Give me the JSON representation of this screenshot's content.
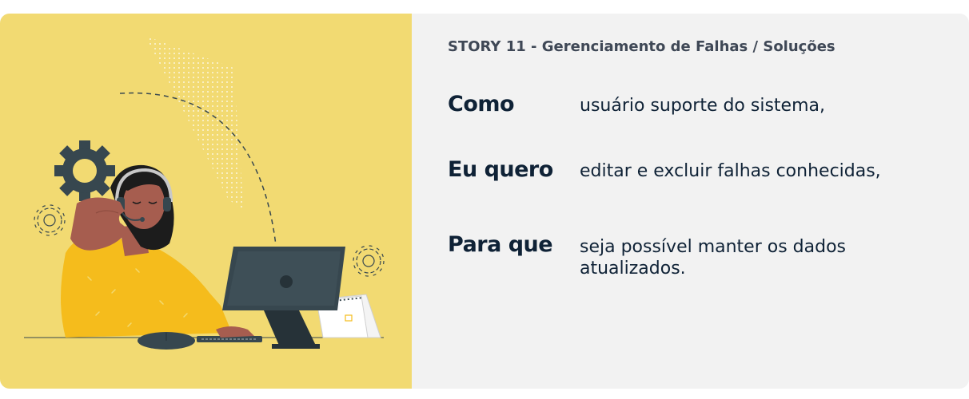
{
  "story": {
    "title": "STORY 11 - Gerenciamento de Falhas / Soluções"
  },
  "rows": [
    {
      "label": "Como",
      "text": "usuário suporte do sistema,"
    },
    {
      "label": "Eu quero",
      "text": "editar e excluir falhas conhecidas,"
    },
    {
      "label": "Para que",
      "text": "seja possível manter os dados atualizados."
    }
  ],
  "illustration": {
    "icon": "support-agent-illustration",
    "colors": {
      "background": "#f2da72",
      "shirt": "#f5bc1c",
      "skin": "#a65d4f",
      "hair": "#1c1c1c",
      "monitor": "#37474f",
      "gear": "#37474f"
    }
  },
  "colors": {
    "panel_background": "#f2f2f2",
    "heading_text": "#0f2236",
    "title_text": "#3f4856"
  }
}
